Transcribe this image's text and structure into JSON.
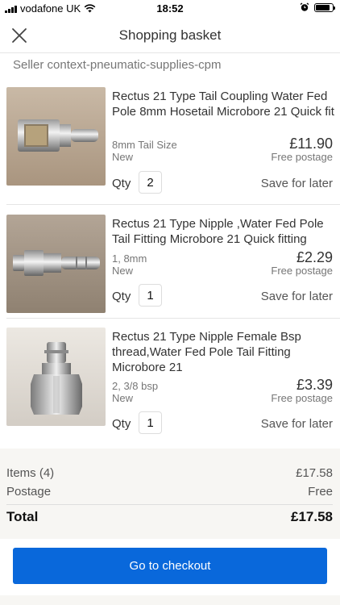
{
  "status_bar": {
    "carrier": "vodafone UK",
    "time": "18:52",
    "signal_icon": "signal-bars-icon",
    "wifi_icon": "wifi-icon",
    "alarm_icon": "alarm-clock-icon",
    "battery_icon": "battery-icon",
    "battery_level": 0.85
  },
  "header": {
    "title": "Shopping basket",
    "close_icon": "close-icon"
  },
  "seller": {
    "label": "Seller context-pneumatic-supplies-cpm"
  },
  "items": [
    {
      "title": "Rectus 21 Type Tail Coupling Water Fed Pole 8mm Hosetail Microbore 21 Quick fit",
      "variant": "8mm Tail  Size",
      "condition": "New",
      "price": "£11.90",
      "postage": "Free postage",
      "qty_label": "Qty",
      "qty": "2",
      "save_label": "Save for later"
    },
    {
      "title": "Rectus 21 Type Nipple ,Water Fed Pole Tail Fitting Microbore 21 Quick fitting",
      "variant": "1, 8mm",
      "condition": "New",
      "price": "£2.29",
      "postage": "Free postage",
      "qty_label": "Qty",
      "qty": "1",
      "save_label": "Save for later"
    },
    {
      "title": "Rectus 21 Type Nipple Female Bsp thread,Water Fed Pole Tail Fitting Microbore 21",
      "variant": "2, 3/8 bsp",
      "condition": "New",
      "price": "£3.39",
      "postage": "Free postage",
      "qty_label": "Qty",
      "qty": "1",
      "save_label": "Save for later"
    }
  ],
  "summary": {
    "items_label": "Items (4)",
    "items_value": "£17.58",
    "postage_label": "Postage",
    "postage_value": "Free",
    "total_label": "Total",
    "total_value": "£17.58"
  },
  "checkout": {
    "label": "Go to checkout"
  },
  "colors": {
    "accent": "#0968db",
    "summary_bg": "#f7f6f3",
    "muted_text": "#767676"
  }
}
